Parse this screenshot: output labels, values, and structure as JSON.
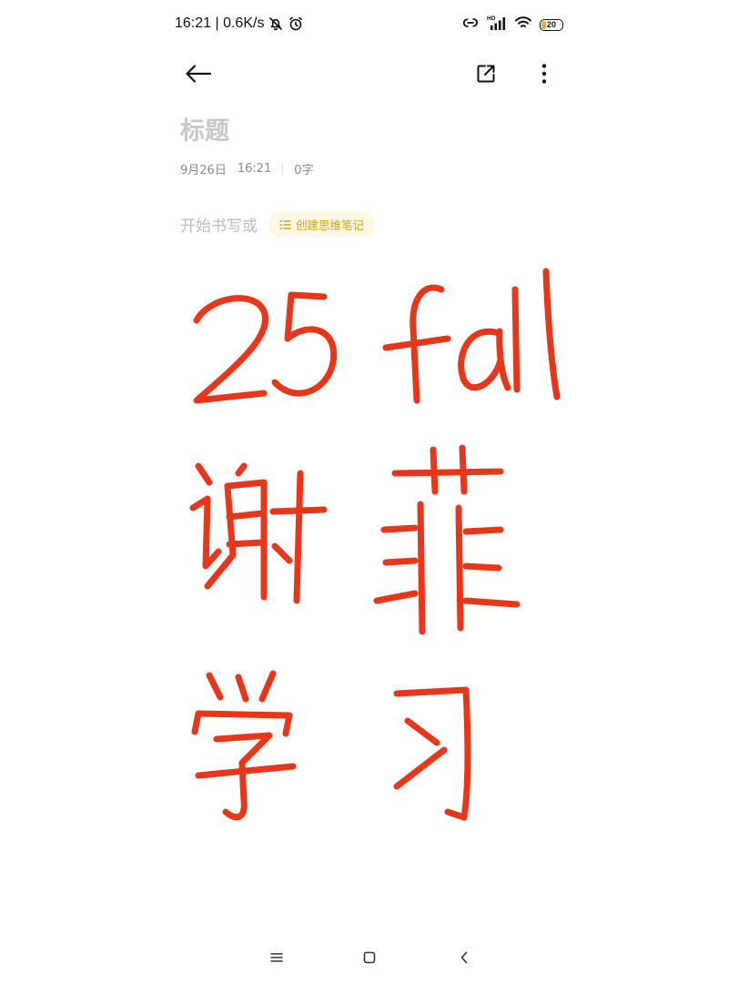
{
  "status_bar": {
    "time_speed": "16:21 | 0.6K/s",
    "battery_level": "20",
    "battery_fill_fraction": 0.2,
    "icons": [
      "silent-bell-icon",
      "alarm-icon",
      "link-icon",
      "hd-signal-icon",
      "wifi-icon",
      "battery-icon"
    ]
  },
  "toolbar": {
    "icons": [
      "back-arrow-icon",
      "share-icon",
      "more-vertical-icon"
    ]
  },
  "note": {
    "title_placeholder": "标题",
    "date": "9月26日",
    "time": "16:21",
    "word_count": "0字",
    "body_prompt": "开始书写或",
    "mindmap_button_label": "创建思维笔记"
  },
  "handwriting": {
    "color": "#e8361a",
    "lines": [
      "25 fall",
      "谢菲",
      "学习"
    ]
  },
  "nav_bar": {
    "icons": [
      "menu-icon",
      "home-square-icon",
      "back-chevron-icon"
    ]
  },
  "colors": {
    "accent": "#d9a21a",
    "accent_bg": "#fff8e6",
    "battery": "#f0a83a"
  }
}
